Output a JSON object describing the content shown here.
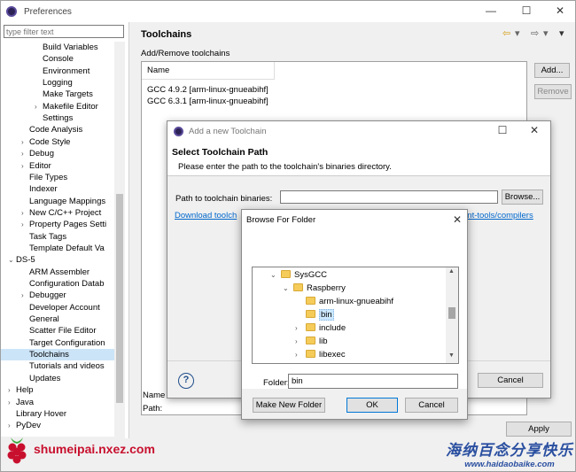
{
  "window": {
    "title": "Preferences"
  },
  "filter": {
    "placeholder": "type filter text"
  },
  "tree": [
    {
      "label": "Build Variables",
      "indent": 3,
      "arrow": ""
    },
    {
      "label": "Console",
      "indent": 3,
      "arrow": ""
    },
    {
      "label": "Environment",
      "indent": 3,
      "arrow": ""
    },
    {
      "label": "Logging",
      "indent": 3,
      "arrow": ""
    },
    {
      "label": "Make Targets",
      "indent": 3,
      "arrow": ""
    },
    {
      "label": "Makefile Editor",
      "indent": 3,
      "arrow": ">"
    },
    {
      "label": "Settings",
      "indent": 3,
      "arrow": ""
    },
    {
      "label": "Code Analysis",
      "indent": 2,
      "arrow": ""
    },
    {
      "label": "Code Style",
      "indent": 2,
      "arrow": ">"
    },
    {
      "label": "Debug",
      "indent": 2,
      "arrow": ">"
    },
    {
      "label": "Editor",
      "indent": 2,
      "arrow": ">"
    },
    {
      "label": "File Types",
      "indent": 2,
      "arrow": ""
    },
    {
      "label": "Indexer",
      "indent": 2,
      "arrow": ""
    },
    {
      "label": "Language Mappings",
      "indent": 2,
      "arrow": ""
    },
    {
      "label": "New C/C++ Project",
      "indent": 2,
      "arrow": ">"
    },
    {
      "label": "Property Pages Setti",
      "indent": 2,
      "arrow": ">"
    },
    {
      "label": "Task Tags",
      "indent": 2,
      "arrow": ""
    },
    {
      "label": "Template Default Va",
      "indent": 2,
      "arrow": ""
    },
    {
      "label": "DS-5",
      "indent": 1,
      "arrow": "v"
    },
    {
      "label": "ARM Assembler",
      "indent": 2,
      "arrow": ""
    },
    {
      "label": "Configuration Datab",
      "indent": 2,
      "arrow": ""
    },
    {
      "label": "Debugger",
      "indent": 2,
      "arrow": ">"
    },
    {
      "label": "Developer Account",
      "indent": 2,
      "arrow": ""
    },
    {
      "label": "General",
      "indent": 2,
      "arrow": ""
    },
    {
      "label": "Scatter File Editor",
      "indent": 2,
      "arrow": ""
    },
    {
      "label": "Target Configuration",
      "indent": 2,
      "arrow": ""
    },
    {
      "label": "Toolchains",
      "indent": 2,
      "arrow": "",
      "selected": true
    },
    {
      "label": "Tutorials and videos",
      "indent": 2,
      "arrow": ""
    },
    {
      "label": "Updates",
      "indent": 2,
      "arrow": ""
    },
    {
      "label": "Help",
      "indent": 1,
      "arrow": ">"
    },
    {
      "label": "Java",
      "indent": 1,
      "arrow": ">"
    },
    {
      "label": "Library Hover",
      "indent": 1,
      "arrow": ""
    },
    {
      "label": "PyDev",
      "indent": 1,
      "arrow": ">"
    }
  ],
  "panel": {
    "title": "Toolchains",
    "section": "Add/Remove toolchains",
    "column_name": "Name",
    "rows": [
      "GCC 4.9.2 [arm-linux-gnueabihf]",
      "GCC 6.3.1 [arm-linux-gnueabihf]"
    ],
    "add_label": "Add...",
    "remove_label": "Remove",
    "name_label": "Name",
    "path_label": "Path:",
    "apply_label": "Apply"
  },
  "tc_dialog": {
    "title": "Add a new Toolchain",
    "heading": "Select Toolchain Path",
    "description": "Please enter the path to the toolchain's binaries directory.",
    "path_label": "Path to toolchain binaries:",
    "browse_label": "Browse...",
    "link_text": "Download toolch",
    "link_tail": "ent-tools/compilers",
    "cancel_label": "Cancel",
    "help": "?"
  },
  "browse_dialog": {
    "title": "Browse For Folder",
    "folders": [
      {
        "label": "SysGCC",
        "level": 0,
        "arrow": "v"
      },
      {
        "label": "Raspberry",
        "level": 1,
        "arrow": "v"
      },
      {
        "label": "arm-linux-gnueabihf",
        "level": 2,
        "arrow": ""
      },
      {
        "label": "bin",
        "level": 2,
        "arrow": "",
        "selected": true
      },
      {
        "label": "include",
        "level": 2,
        "arrow": ">"
      },
      {
        "label": "lib",
        "level": 2,
        "arrow": ">"
      },
      {
        "label": "libexec",
        "level": 2,
        "arrow": ">"
      }
    ],
    "folder_label": "Folder:",
    "folder_value": "bin",
    "new_folder_label": "Make New Folder",
    "ok_label": "OK",
    "cancel_label": "Cancel"
  },
  "watermarks": {
    "left_text": "shumeipai.nxez.com",
    "right_cn": "海纳百念分享快乐",
    "right_url": "www.haidaobaike.com"
  },
  "colors": {
    "selection": "#cce4f7",
    "link": "#0066cc",
    "watermark_red": "#c8102e",
    "watermark_blue": "#2a4fa0"
  }
}
